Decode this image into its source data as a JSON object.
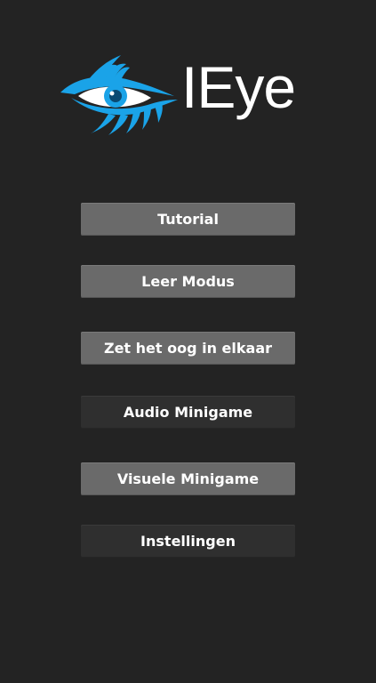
{
  "app": {
    "logo_text": "IEye",
    "brand_color": "#1aa3e8",
    "logo_icon": "eye-icon"
  },
  "menu": {
    "buttons": [
      {
        "label": "Tutorial",
        "style": "light"
      },
      {
        "label": "Leer Modus",
        "style": "light"
      },
      {
        "label": "Zet het oog in elkaar",
        "style": "light"
      },
      {
        "label": "Audio Minigame",
        "style": "dark"
      },
      {
        "label": "Visuele Minigame",
        "style": "light"
      },
      {
        "label": "Instellingen",
        "style": "dark"
      }
    ]
  },
  "colors": {
    "background": "#232323",
    "button_light": "#6a6a6a",
    "button_dark": "#2f2f2f",
    "text": "#ffffff"
  }
}
